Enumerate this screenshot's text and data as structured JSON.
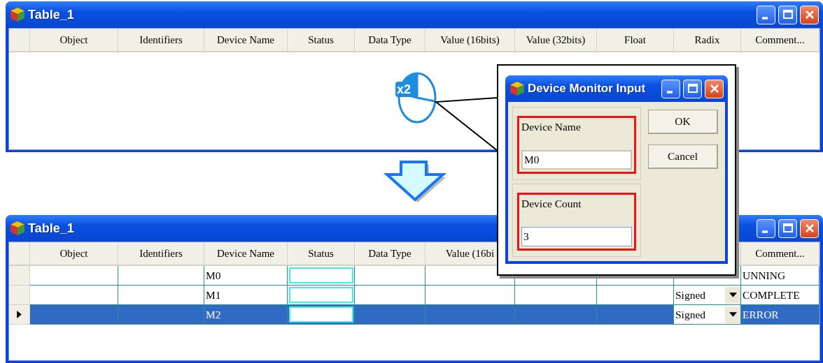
{
  "windows": [
    {
      "title": "Table_1",
      "columns": [
        {
          "label": "Object"
        },
        {
          "label": "Identifiers"
        },
        {
          "label": "Device Name"
        },
        {
          "label": "Status"
        },
        {
          "label": "Data Type"
        },
        {
          "label": "Value (16bits)"
        },
        {
          "label": "Value (32bits)"
        },
        {
          "label": "Float"
        },
        {
          "label": "Radix"
        },
        {
          "label": "Comment..."
        }
      ]
    },
    {
      "title": "Table_1",
      "columns": [
        {
          "label": "Object"
        },
        {
          "label": "Identifiers"
        },
        {
          "label": "Device Name"
        },
        {
          "label": "Status"
        },
        {
          "label": "Data Type"
        },
        {
          "label": "Value (16bi"
        },
        {},
        {},
        {},
        {
          "label": "Comment..."
        }
      ],
      "rows": [
        {
          "device_name": "M0",
          "comment": "UNNING",
          "selected": false
        },
        {
          "device_name": "M1",
          "radix": "Signed",
          "comment": "COMPLETE",
          "selected": false
        },
        {
          "device_name": "M2",
          "radix": "Signed",
          "comment": "ERROR",
          "selected": true
        }
      ]
    }
  ],
  "callout": {
    "click_count": "x2",
    "dialog": {
      "title": "Device Monitor Input",
      "groups": [
        {
          "label": "Device Name",
          "value": "M0",
          "highlighted": true
        },
        {
          "label": "Device Count",
          "value": "3",
          "highlighted": true
        }
      ],
      "buttons": [
        "OK",
        "Cancel"
      ]
    }
  }
}
